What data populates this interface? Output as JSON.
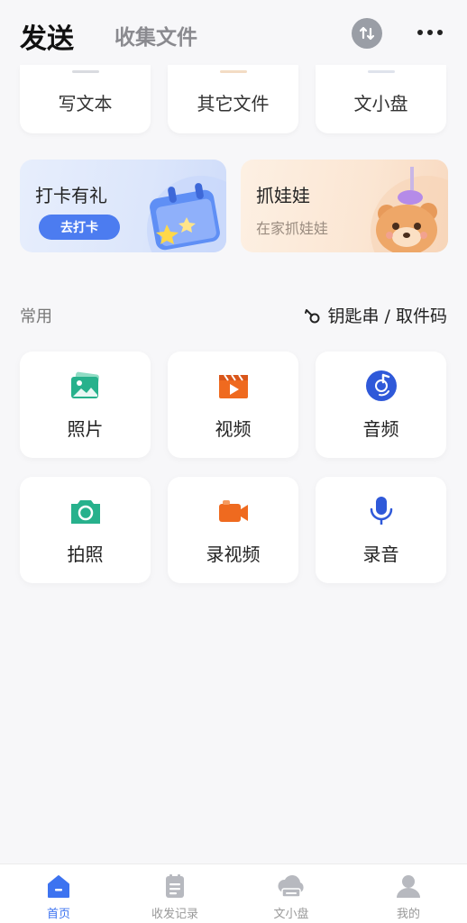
{
  "header": {
    "tab_send": "发送",
    "tab_collect": "收集文件",
    "sort_icon": "sort-arrows-icon",
    "more_icon": "more-icon"
  },
  "top_row": [
    {
      "label": "写文本",
      "nub_color": "#d9dbe0"
    },
    {
      "label": "其它文件",
      "nub_color": "#f3dcc4"
    },
    {
      "label": "文小盘",
      "nub_color": "#dfe3ec"
    }
  ],
  "banners": {
    "checkin": {
      "title": "打卡有礼",
      "button": "去打卡"
    },
    "claw": {
      "title": "抓娃娃",
      "subtitle": "在家抓娃娃"
    }
  },
  "common": {
    "title": "常用",
    "keychain_link": "钥匙串 / 取件码",
    "tiles": [
      {
        "label": "照片",
        "icon": "photo-icon",
        "color": "#27b18c"
      },
      {
        "label": "视频",
        "icon": "video-icon",
        "color": "#ef6a1f"
      },
      {
        "label": "音频",
        "icon": "music-icon",
        "color": "#2f59d9"
      },
      {
        "label": "拍照",
        "icon": "camera-icon",
        "color": "#27b18c"
      },
      {
        "label": "录视频",
        "icon": "video-record-icon",
        "color": "#ef6a1f"
      },
      {
        "label": "录音",
        "icon": "microphone-icon",
        "color": "#2f59d9"
      }
    ]
  },
  "bottom_nav": [
    {
      "label": "首页",
      "icon": "home-icon",
      "active": true
    },
    {
      "label": "收发记录",
      "icon": "records-icon",
      "active": false
    },
    {
      "label": "文小盘",
      "icon": "cloud-disk-icon",
      "active": false
    },
    {
      "label": "我的",
      "icon": "profile-icon",
      "active": false
    }
  ],
  "colors": {
    "accent": "#3d73f0",
    "background": "#f7f7f9"
  }
}
